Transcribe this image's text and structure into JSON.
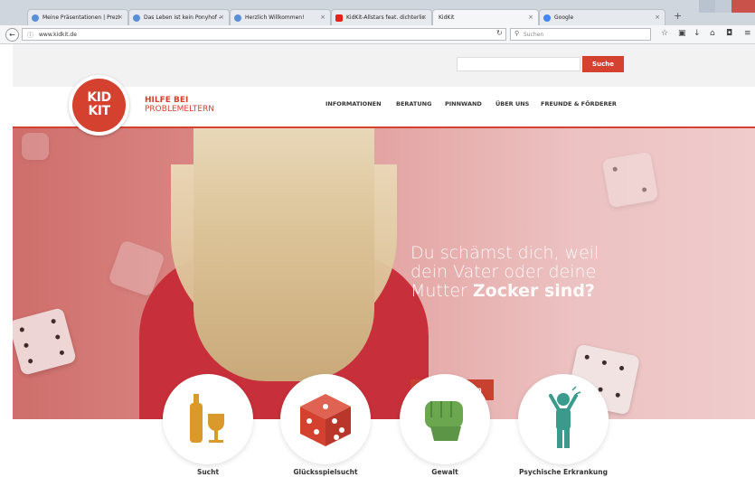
{
  "browser": {
    "tabs": [
      {
        "label": "Meine Präsentationen | Prezi"
      },
      {
        "label": "Das Leben ist kein Ponyhof - "
      },
      {
        "label": "Herzlich Willkommen!"
      },
      {
        "label": "KidKit-Allstars feat. dichterlic"
      },
      {
        "label": "KidKit"
      },
      {
        "label": "Google"
      }
    ],
    "new_tab": "+",
    "url": "www.kidkit.de",
    "search_placeholder": "Suchen"
  },
  "site": {
    "search_button": "Suche",
    "logo_line1": "KID",
    "logo_line2": "KIT",
    "tagline_line1": "HILFE BEI",
    "tagline_line2": "PROBLEMELTERN",
    "nav": [
      {
        "label": "INFORMATIONEN"
      },
      {
        "label": "BERATUNG"
      },
      {
        "label": "PINNWAND"
      },
      {
        "label": "ÜBER UNS"
      },
      {
        "label": "FREUNDE & FÖRDERER"
      }
    ]
  },
  "hero": {
    "headline_line1": "Du schämst dich, weil",
    "headline_line2": "dein Vater oder deine",
    "headline_line3_prefix": "Mutter ",
    "headline_emphasis": "Zocker sind?",
    "cta": "Deine Situation"
  },
  "categories": [
    {
      "label": "Sucht",
      "icon": "bottle-glass-icon",
      "color": "#d99a2b"
    },
    {
      "label": "Glücksspielsucht",
      "icon": "dice-icon",
      "color": "#d5412f"
    },
    {
      "label": "Gewalt",
      "icon": "fist-icon",
      "color": "#6aa74f"
    },
    {
      "label": "Psychische Erkrankung",
      "icon": "stressed-person-icon",
      "color": "#3a9a8c"
    }
  ],
  "colors": {
    "brand": "#d5412f"
  }
}
